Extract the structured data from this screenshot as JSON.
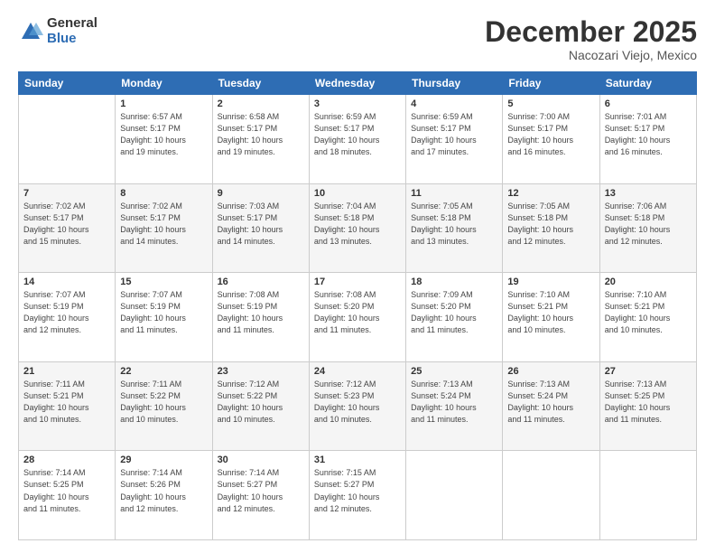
{
  "logo": {
    "general": "General",
    "blue": "Blue"
  },
  "header": {
    "month": "December 2025",
    "location": "Nacozari Viejo, Mexico"
  },
  "weekdays": [
    "Sunday",
    "Monday",
    "Tuesday",
    "Wednesday",
    "Thursday",
    "Friday",
    "Saturday"
  ],
  "weeks": [
    [
      {
        "day": "",
        "info": ""
      },
      {
        "day": "1",
        "info": "Sunrise: 6:57 AM\nSunset: 5:17 PM\nDaylight: 10 hours\nand 19 minutes."
      },
      {
        "day": "2",
        "info": "Sunrise: 6:58 AM\nSunset: 5:17 PM\nDaylight: 10 hours\nand 19 minutes."
      },
      {
        "day": "3",
        "info": "Sunrise: 6:59 AM\nSunset: 5:17 PM\nDaylight: 10 hours\nand 18 minutes."
      },
      {
        "day": "4",
        "info": "Sunrise: 6:59 AM\nSunset: 5:17 PM\nDaylight: 10 hours\nand 17 minutes."
      },
      {
        "day": "5",
        "info": "Sunrise: 7:00 AM\nSunset: 5:17 PM\nDaylight: 10 hours\nand 16 minutes."
      },
      {
        "day": "6",
        "info": "Sunrise: 7:01 AM\nSunset: 5:17 PM\nDaylight: 10 hours\nand 16 minutes."
      }
    ],
    [
      {
        "day": "7",
        "info": "Sunrise: 7:02 AM\nSunset: 5:17 PM\nDaylight: 10 hours\nand 15 minutes."
      },
      {
        "day": "8",
        "info": "Sunrise: 7:02 AM\nSunset: 5:17 PM\nDaylight: 10 hours\nand 14 minutes."
      },
      {
        "day": "9",
        "info": "Sunrise: 7:03 AM\nSunset: 5:17 PM\nDaylight: 10 hours\nand 14 minutes."
      },
      {
        "day": "10",
        "info": "Sunrise: 7:04 AM\nSunset: 5:18 PM\nDaylight: 10 hours\nand 13 minutes."
      },
      {
        "day": "11",
        "info": "Sunrise: 7:05 AM\nSunset: 5:18 PM\nDaylight: 10 hours\nand 13 minutes."
      },
      {
        "day": "12",
        "info": "Sunrise: 7:05 AM\nSunset: 5:18 PM\nDaylight: 10 hours\nand 12 minutes."
      },
      {
        "day": "13",
        "info": "Sunrise: 7:06 AM\nSunset: 5:18 PM\nDaylight: 10 hours\nand 12 minutes."
      }
    ],
    [
      {
        "day": "14",
        "info": "Sunrise: 7:07 AM\nSunset: 5:19 PM\nDaylight: 10 hours\nand 12 minutes."
      },
      {
        "day": "15",
        "info": "Sunrise: 7:07 AM\nSunset: 5:19 PM\nDaylight: 10 hours\nand 11 minutes."
      },
      {
        "day": "16",
        "info": "Sunrise: 7:08 AM\nSunset: 5:19 PM\nDaylight: 10 hours\nand 11 minutes."
      },
      {
        "day": "17",
        "info": "Sunrise: 7:08 AM\nSunset: 5:20 PM\nDaylight: 10 hours\nand 11 minutes."
      },
      {
        "day": "18",
        "info": "Sunrise: 7:09 AM\nSunset: 5:20 PM\nDaylight: 10 hours\nand 11 minutes."
      },
      {
        "day": "19",
        "info": "Sunrise: 7:10 AM\nSunset: 5:21 PM\nDaylight: 10 hours\nand 10 minutes."
      },
      {
        "day": "20",
        "info": "Sunrise: 7:10 AM\nSunset: 5:21 PM\nDaylight: 10 hours\nand 10 minutes."
      }
    ],
    [
      {
        "day": "21",
        "info": "Sunrise: 7:11 AM\nSunset: 5:21 PM\nDaylight: 10 hours\nand 10 minutes."
      },
      {
        "day": "22",
        "info": "Sunrise: 7:11 AM\nSunset: 5:22 PM\nDaylight: 10 hours\nand 10 minutes."
      },
      {
        "day": "23",
        "info": "Sunrise: 7:12 AM\nSunset: 5:22 PM\nDaylight: 10 hours\nand 10 minutes."
      },
      {
        "day": "24",
        "info": "Sunrise: 7:12 AM\nSunset: 5:23 PM\nDaylight: 10 hours\nand 10 minutes."
      },
      {
        "day": "25",
        "info": "Sunrise: 7:13 AM\nSunset: 5:24 PM\nDaylight: 10 hours\nand 11 minutes."
      },
      {
        "day": "26",
        "info": "Sunrise: 7:13 AM\nSunset: 5:24 PM\nDaylight: 10 hours\nand 11 minutes."
      },
      {
        "day": "27",
        "info": "Sunrise: 7:13 AM\nSunset: 5:25 PM\nDaylight: 10 hours\nand 11 minutes."
      }
    ],
    [
      {
        "day": "28",
        "info": "Sunrise: 7:14 AM\nSunset: 5:25 PM\nDaylight: 10 hours\nand 11 minutes."
      },
      {
        "day": "29",
        "info": "Sunrise: 7:14 AM\nSunset: 5:26 PM\nDaylight: 10 hours\nand 12 minutes."
      },
      {
        "day": "30",
        "info": "Sunrise: 7:14 AM\nSunset: 5:27 PM\nDaylight: 10 hours\nand 12 minutes."
      },
      {
        "day": "31",
        "info": "Sunrise: 7:15 AM\nSunset: 5:27 PM\nDaylight: 10 hours\nand 12 minutes."
      },
      {
        "day": "",
        "info": ""
      },
      {
        "day": "",
        "info": ""
      },
      {
        "day": "",
        "info": ""
      }
    ]
  ]
}
